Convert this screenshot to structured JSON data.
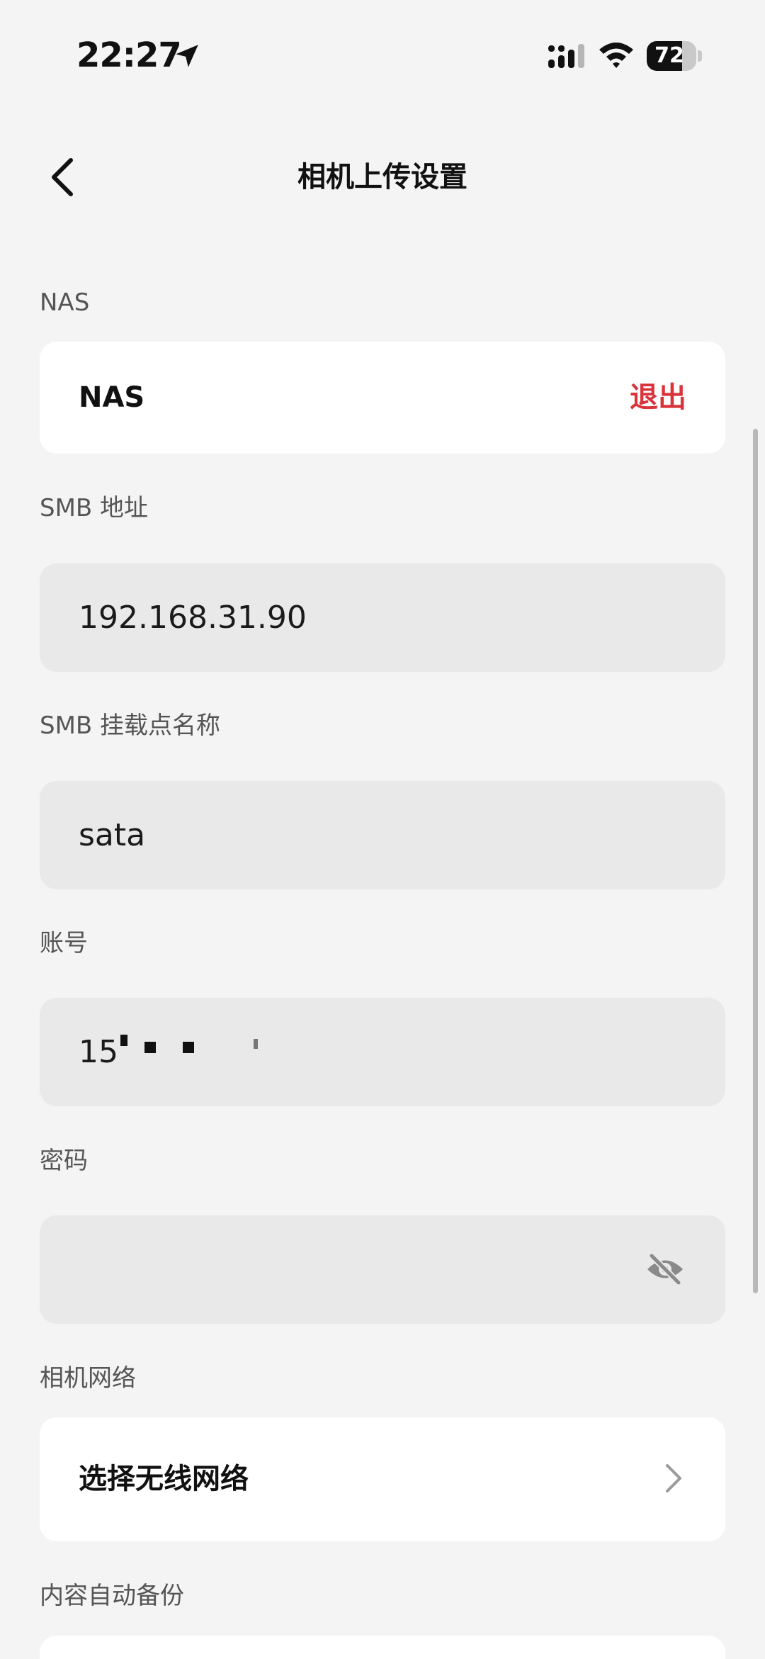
{
  "status_bar": {
    "time": "22:27",
    "battery": "72",
    "battery_level": 0.72,
    "icons": [
      "location-arrow-icon",
      "cellular-signal-icon",
      "wifi-icon",
      "battery-icon"
    ]
  },
  "header": {
    "title": "相机上传设置",
    "back_icon": "chevron-left-icon"
  },
  "nas": {
    "section_label": "NAS",
    "name": "NAS",
    "logout_label": "退出",
    "logout_color": "#d9333b"
  },
  "smb_address": {
    "label": "SMB 地址",
    "value": "192.168.31.90"
  },
  "smb_mount": {
    "label": "SMB 挂载点名称",
    "value": "sata"
  },
  "account": {
    "label": "账号",
    "value": "155     902",
    "redacted": true
  },
  "password": {
    "label": "密码",
    "value": "",
    "visibility_icon": "eye-off-icon"
  },
  "camera_network": {
    "label": "相机网络",
    "select_label": "选择无线网络",
    "chevron_icon": "chevron-right-icon"
  },
  "auto_backup": {
    "label": "内容自动备份"
  }
}
